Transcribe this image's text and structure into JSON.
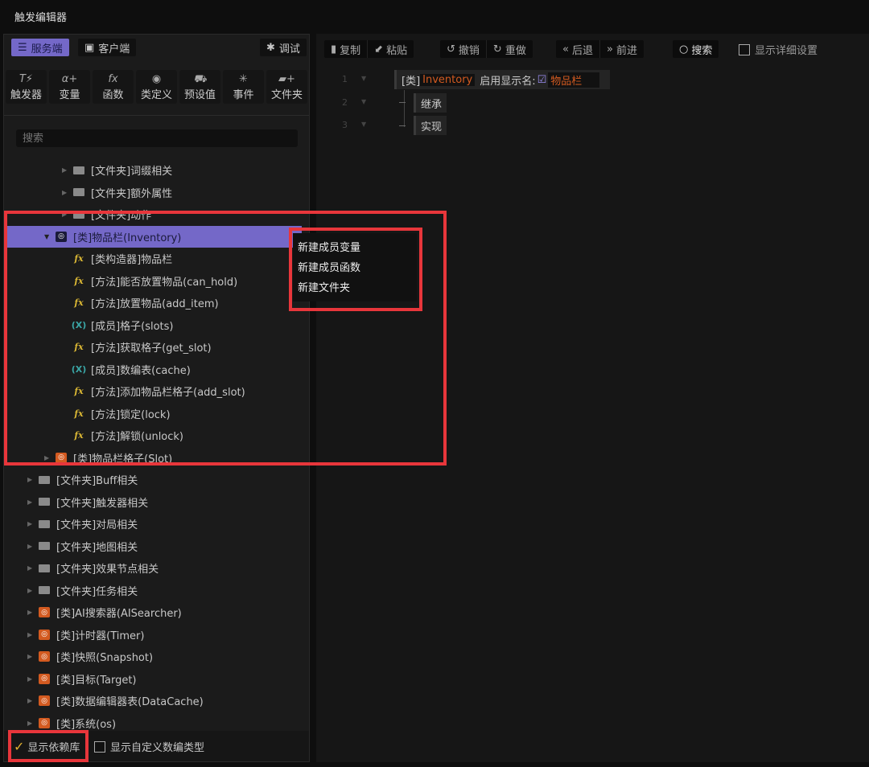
{
  "window": {
    "title": "触发编辑器"
  },
  "left": {
    "tabs": [
      {
        "label": "服务端",
        "icon": "server-icon",
        "active": true
      },
      {
        "label": "客户端",
        "icon": "client-icon",
        "active": false
      }
    ],
    "debug_label": "调试",
    "tools": [
      {
        "label": "触发器",
        "icon": "T⚡"
      },
      {
        "label": "变量",
        "icon": "α+"
      },
      {
        "label": "函数",
        "icon": "fx"
      },
      {
        "label": "类定义",
        "icon": "◉"
      },
      {
        "label": "预设值",
        "icon": "⛟"
      },
      {
        "label": "事件",
        "icon": "✳"
      },
      {
        "label": "文件夹",
        "icon": "▰+"
      }
    ],
    "search_placeholder": "搜索",
    "tree": [
      {
        "label": "[文件夹]词缀相关",
        "type": "folder",
        "level": 2
      },
      {
        "label": "[文件夹]额外属性",
        "type": "folder",
        "level": 2
      },
      {
        "label": "[文件夹]动作",
        "type": "folder",
        "level": 2
      },
      {
        "label": "[类]物品栏(Inventory)",
        "type": "class",
        "level": 1,
        "selected": true,
        "expanded": true
      },
      {
        "label": "[类构造器]物品栏",
        "type": "fx",
        "level": 2
      },
      {
        "label": "[方法]能否放置物品(can_hold)",
        "type": "fx",
        "level": 2
      },
      {
        "label": "[方法]放置物品(add_item)",
        "type": "fx",
        "level": 2
      },
      {
        "label": "[成员]格子(slots)",
        "type": "member",
        "level": 2
      },
      {
        "label": "[方法]获取格子(get_slot)",
        "type": "fx",
        "level": 2
      },
      {
        "label": "[成员]数编表(cache)",
        "type": "member",
        "level": 2
      },
      {
        "label": "[方法]添加物品栏格子(add_slot)",
        "type": "fx",
        "level": 2
      },
      {
        "label": "[方法]锁定(lock)",
        "type": "fx",
        "level": 2
      },
      {
        "label": "[方法]解锁(unlock)",
        "type": "fx",
        "level": 2
      },
      {
        "label": "[类]物品栏格子(Slot)",
        "type": "class",
        "level": 1
      },
      {
        "label": "[文件夹]Buff相关",
        "type": "folder",
        "level": 0
      },
      {
        "label": "[文件夹]触发器相关",
        "type": "folder",
        "level": 0
      },
      {
        "label": "[文件夹]对局相关",
        "type": "folder",
        "level": 0
      },
      {
        "label": "[文件夹]地图相关",
        "type": "folder",
        "level": 0
      },
      {
        "label": "[文件夹]效果节点相关",
        "type": "folder",
        "level": 0
      },
      {
        "label": "[文件夹]任务相关",
        "type": "folder",
        "level": 0
      },
      {
        "label": "[类]AI搜索器(AISearcher)",
        "type": "class",
        "level": 0
      },
      {
        "label": "[类]计时器(Timer)",
        "type": "class",
        "level": 0
      },
      {
        "label": "[类]快照(Snapshot)",
        "type": "class",
        "level": 0
      },
      {
        "label": "[类]目标(Target)",
        "type": "class",
        "level": 0
      },
      {
        "label": "[类]数据编辑器表(DataCache)",
        "type": "class",
        "level": 0
      },
      {
        "label": "[类]系统(os)",
        "type": "class",
        "level": 0
      }
    ],
    "footer": {
      "show_deps": "显示依赖库",
      "show_deps_checked": true,
      "show_custom": "显示自定义数编类型",
      "show_custom_checked": false
    }
  },
  "context_menu": [
    "新建成员变量",
    "新建成员函数",
    "新建文件夹"
  ],
  "toolbar": {
    "copy": "复制",
    "paste": "粘贴",
    "undo": "撤销",
    "redo": "重做",
    "back": "后退",
    "forward": "前进",
    "search": "搜索",
    "detail": "显示详细设置"
  },
  "editor": {
    "lines": [
      "1",
      "2",
      "3"
    ],
    "class_prefix": "[类]",
    "class_name": "Inventory",
    "display_label": "启用显示名:",
    "display_checked": true,
    "display_name": "物品栏",
    "inherit": "继承",
    "implement": "实现"
  },
  "colors": {
    "accent": "#7468c8",
    "highlight": "#e8363b",
    "class_icon": "#d35a20",
    "fx": "#d9b634",
    "member": "#3aa6a6"
  }
}
